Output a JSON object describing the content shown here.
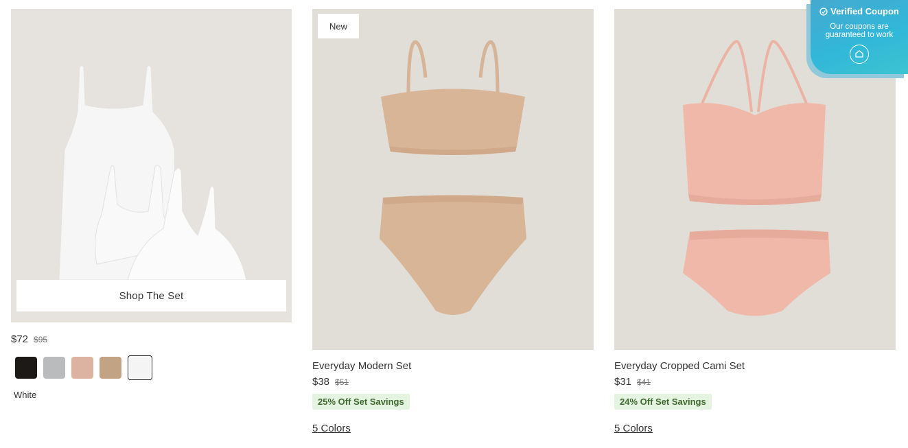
{
  "products": [
    {
      "shop_label": "Shop The Set",
      "price": "$72",
      "old_price": "$95",
      "swatch_colors": [
        "#1c1917",
        "#b9bbbc",
        "#dcb3a0",
        "#c2a384",
        "#f4f4f4"
      ],
      "selected_color": "White"
    },
    {
      "badge": "New",
      "name": "Everyday Modern Set",
      "price": "$38",
      "old_price": "$51",
      "savings": "25% Off Set Savings",
      "colors_link": "5 Colors"
    },
    {
      "name": "Everyday Cropped Cami Set",
      "price": "$31",
      "old_price": "$41",
      "savings": "24% Off Set Savings",
      "colors_link": "5 Colors"
    }
  ],
  "coupon": {
    "title": "Verified Coupon",
    "subtitle": "Our coupons are guaranteed to work"
  },
  "colors": {
    "image_bg": "#e3dfda",
    "savings_bg": "#e5f3e1",
    "savings_text": "#3f6b2e",
    "coupon_blue": "#31b7d9"
  }
}
